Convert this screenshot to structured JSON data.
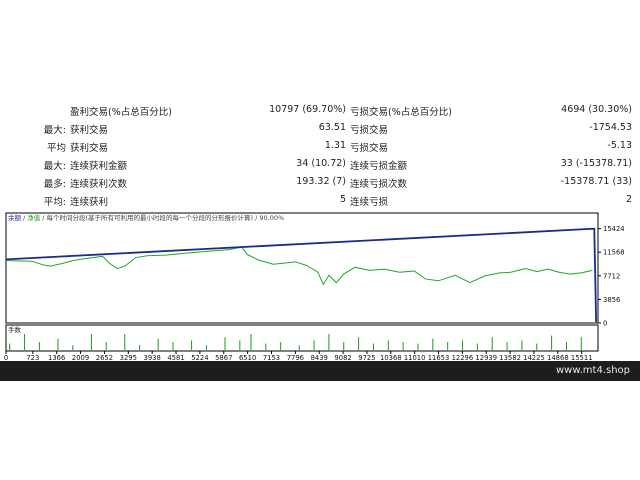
{
  "report": {
    "rows": [
      {
        "label": "",
        "name": "盈利交易(%占总百分比)",
        "value1": "10797 (69.70%)",
        "name2": "亏损交易(%占总百分比)",
        "value2": "4694 (30.30%)"
      },
      {
        "label": "最大:",
        "name": "获利交易",
        "value1": "63.51",
        "name2": "亏损交易",
        "value2": "-1754.53"
      },
      {
        "label": "平均",
        "name": "获利交易",
        "value1": "1.31",
        "name2": "亏损交易",
        "value2": "-5.13"
      },
      {
        "label": "最大:",
        "name": "连续获利金额",
        "value1": "34 (10.72)",
        "name2": "连续亏损金额",
        "value2": "33 (-15378.71)"
      },
      {
        "label": "最多:",
        "name": "连续获利次数",
        "value1": "193.32 (7)",
        "name2": "连续亏损次数",
        "value2": "-15378.71 (33)"
      },
      {
        "label": "平均:",
        "name": "连续获利",
        "value1": "5",
        "name2": "连续亏损",
        "value2": "2"
      }
    ]
  },
  "chart_data": {
    "type": "line",
    "legend": [
      {
        "text": "余额",
        "color": "#1a1aa0"
      },
      {
        "text": "/",
        "color": "#444444"
      },
      {
        "text": "净值",
        "color": "#1aa01a"
      },
      {
        "text": "/ 每个时间分段(基于所有可利用的最小时段的每一个分段的分形报价计算) / 90.00%",
        "color": "#444444"
      }
    ],
    "volume_label": "手数",
    "y_ticks": [
      "15424",
      "11568",
      "7712",
      "3856",
      "0"
    ],
    "x_ticks": [
      "0",
      "723",
      "1366",
      "2009",
      "2652",
      "3295",
      "3938",
      "4581",
      "5224",
      "5867",
      "6510",
      "7153",
      "7796",
      "8439",
      "9082",
      "9725",
      "10368",
      "11010",
      "11653",
      "12296",
      "12939",
      "13582",
      "14225",
      "14868",
      "15511"
    ],
    "ylim": [
      0,
      17000
    ],
    "xlim": [
      0,
      15950
    ],
    "colors": {
      "balance": "#1c2a8c",
      "equity": "#22a822",
      "volume": "#0fa00f",
      "footer": "#1d1d1d"
    },
    "series": [
      {
        "name": "余额",
        "x": [
          0,
          15800,
          15850,
          15900
        ],
        "y": [
          10400,
          15400,
          15400,
          150
        ]
      },
      {
        "name": "净值",
        "x": [
          0,
          700,
          1000,
          1200,
          1500,
          1800,
          2100,
          2600,
          2800,
          3000,
          3200,
          3500,
          3800,
          4300,
          5000,
          6000,
          6350,
          6500,
          6800,
          7200,
          7800,
          8100,
          8400,
          8550,
          8700,
          8900,
          9100,
          9400,
          9800,
          10200,
          10600,
          11000,
          11300,
          11650,
          12100,
          12500,
          12900,
          13300,
          13600,
          14000,
          14300,
          14600,
          14900,
          15200,
          15500,
          15800
        ],
        "y": [
          10200,
          10100,
          9500,
          9300,
          9700,
          10200,
          10500,
          10900,
          9700,
          8900,
          9300,
          10700,
          11000,
          11100,
          11500,
          12000,
          12400,
          11200,
          10300,
          9600,
          10000,
          9400,
          8300,
          6300,
          7800,
          6600,
          8000,
          9100,
          8600,
          8800,
          8300,
          8500,
          7200,
          6900,
          7800,
          6600,
          7700,
          8200,
          8300,
          8900,
          8400,
          8800,
          8300,
          8000,
          8200,
          8600
        ]
      },
      {
        "name": "手数",
        "x": [
          100,
          500,
          900,
          1400,
          1800,
          2300,
          2700,
          3200,
          3600,
          4100,
          4500,
          5000,
          5400,
          5900,
          6300,
          6600,
          7000,
          7400,
          7900,
          8300,
          8700,
          9100,
          9500,
          9900,
          10300,
          10700,
          11100,
          11500,
          11900,
          12300,
          12700,
          13100,
          13500,
          13900,
          14300,
          14700,
          15100,
          15500
        ],
        "y": [
          0.4,
          1.0,
          0.5,
          0.7,
          0.3,
          1.0,
          0.5,
          1.0,
          0.3,
          0.7,
          0.5,
          0.6,
          0.3,
          0.8,
          0.6,
          1.0,
          0.4,
          0.5,
          0.3,
          0.6,
          1.0,
          0.5,
          0.8,
          0.4,
          0.6,
          0.5,
          0.4,
          0.7,
          0.5,
          0.6,
          0.4,
          0.8,
          0.5,
          0.6,
          0.4,
          0.9,
          0.5,
          0.8
        ]
      }
    ]
  },
  "footer": {
    "site": "www.mt4.shop"
  }
}
